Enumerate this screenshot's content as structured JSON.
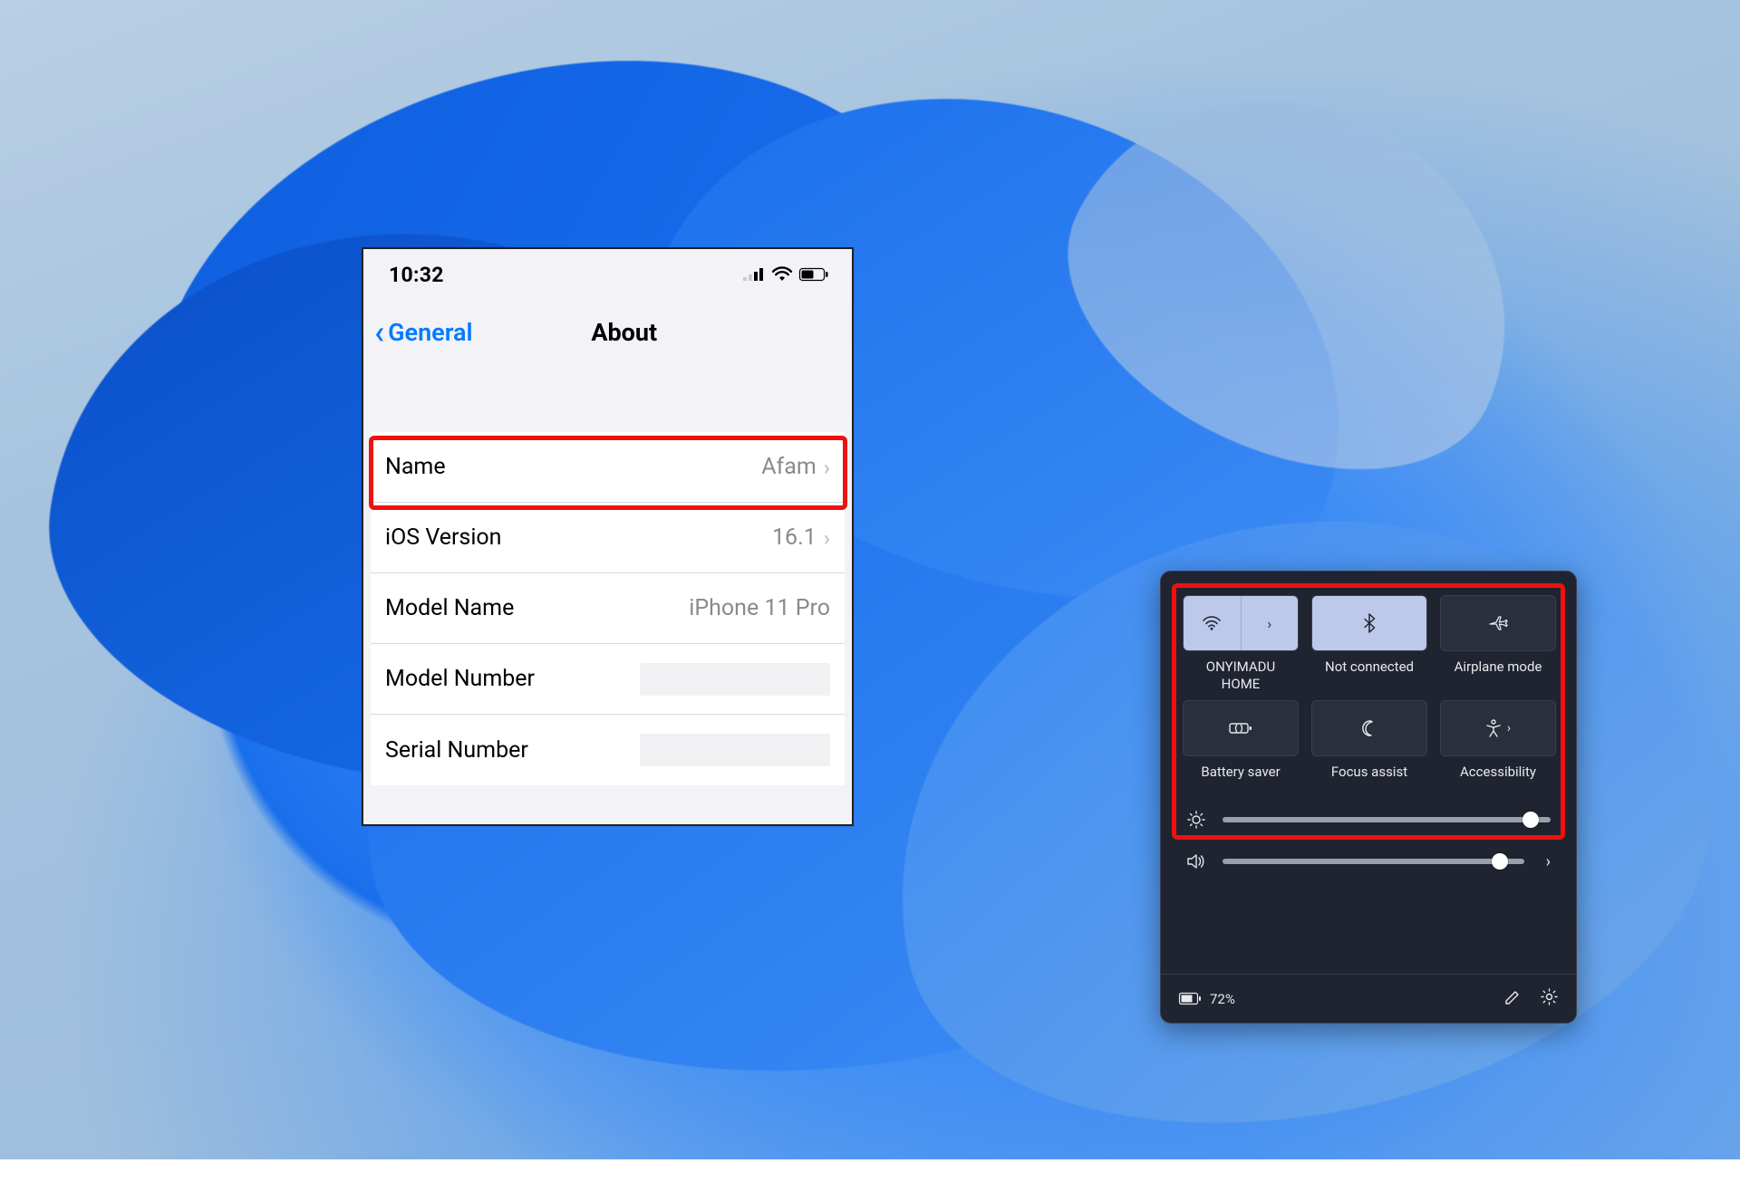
{
  "ios": {
    "time": "10:32",
    "back_label": "General",
    "title": "About",
    "rows": {
      "name": {
        "label": "Name",
        "value": "Afam"
      },
      "ios_version": {
        "label": "iOS Version",
        "value": "16.1"
      },
      "model_name": {
        "label": "Model Name",
        "value": "iPhone 11 Pro"
      },
      "model_number": {
        "label": "Model Number",
        "value": ""
      },
      "serial_number": {
        "label": "Serial Number",
        "value": ""
      }
    }
  },
  "qs": {
    "tiles": {
      "wifi": {
        "label": "ONYIMADU\nHOME"
      },
      "bluetooth": {
        "label": "Not connected"
      },
      "airplane": {
        "label": "Airplane mode"
      },
      "battery": {
        "label": "Battery saver"
      },
      "focus": {
        "label": "Focus assist"
      },
      "accessibility": {
        "label": "Accessibility"
      }
    },
    "sliders": {
      "brightness_pct": 94,
      "volume_pct": 92
    },
    "footer": {
      "battery_text": "72%"
    }
  },
  "colors": {
    "ios_blue": "#007aff",
    "highlight_red": "#ee1111",
    "panel_bg": "#1f2430",
    "tile_active": "#bcc9ea"
  }
}
